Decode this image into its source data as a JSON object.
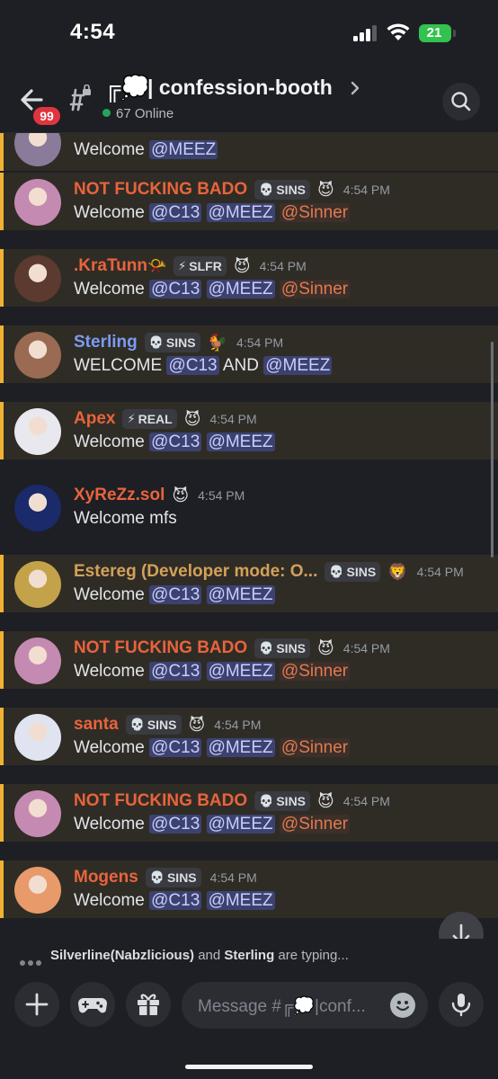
{
  "status_bar": {
    "time": "4:54",
    "battery": "21"
  },
  "header": {
    "unread_badge": "99",
    "channel_emoji": "╔💭",
    "channel_name": "| confession-booth",
    "online": "67 Online"
  },
  "messages": [
    {
      "name": "",
      "name_color": "#e07b4f",
      "tag_icon": "",
      "tag": "",
      "emoji": "",
      "time": "",
      "body": [
        {
          "t": "Welcome "
        },
        {
          "m": "@MEEZ"
        }
      ],
      "highlight": true,
      "avatar": "#8a7b9a"
    },
    {
      "name": "NOT FUCKING BADO",
      "name_color": "#e8643c",
      "tag_icon": "💀",
      "tag": "SINS",
      "emoji": "😈",
      "time": "4:54 PM",
      "body": [
        {
          "t": "Welcome "
        },
        {
          "m": "@C13"
        },
        {
          "t": " "
        },
        {
          "m": "@MEEZ"
        },
        {
          "t": " "
        },
        {
          "r": "@Sinner"
        }
      ],
      "highlight": true,
      "avatar": "#c58ab2"
    },
    {
      "name": ".KraTunn",
      "name_color": "#e8643c",
      "name_suffix": "📯",
      "tag_icon": "⚡",
      "tag": "SLFR",
      "emoji": "😈",
      "time": "4:54 PM",
      "body": [
        {
          "t": "Welcome "
        },
        {
          "m": "@C13"
        },
        {
          "t": " "
        },
        {
          "m": "@MEEZ"
        },
        {
          "t": " "
        },
        {
          "r": "@Sinner"
        }
      ],
      "highlight": true,
      "avatar": "#5c3a30"
    },
    {
      "name": "Sterling",
      "name_color": "#7b9cf0",
      "tag_icon": "💀",
      "tag": "SINS",
      "emoji": "🐓",
      "time": "4:54 PM",
      "body": [
        {
          "t": "WELCOME "
        },
        {
          "m": "@C13"
        },
        {
          "t": " AND "
        },
        {
          "m": "@MEEZ"
        }
      ],
      "highlight": true,
      "avatar": "#9a6a52"
    },
    {
      "name": "Apex",
      "name_color": "#e8643c",
      "tag_icon": "⚡",
      "tag": "REAL",
      "emoji": "😈",
      "time": "4:54 PM",
      "body": [
        {
          "t": "Welcome "
        },
        {
          "m": "@C13"
        },
        {
          "t": " "
        },
        {
          "m": "@MEEZ"
        }
      ],
      "highlight": true,
      "avatar": "#e8e8ee"
    },
    {
      "name": "XyReZz.sol",
      "name_color": "#e8643c",
      "tag_icon": "",
      "tag": "",
      "emoji": "😈",
      "time": "4:54 PM",
      "body": [
        {
          "t": "Welcome mfs"
        }
      ],
      "highlight": false,
      "avatar": "#1a2a6a"
    },
    {
      "name": "Estereg  (Developer mode: O...",
      "name_color": "#d4a15a",
      "tag_icon": "💀",
      "tag": "SINS",
      "emoji": "🦁",
      "time": "4:54 PM",
      "body": [
        {
          "t": "Welcome "
        },
        {
          "m": "@C13"
        },
        {
          "t": " "
        },
        {
          "m": "@MEEZ"
        }
      ],
      "highlight": true,
      "avatar": "#c4a24a"
    },
    {
      "name": "NOT FUCKING BADO",
      "name_color": "#e8643c",
      "tag_icon": "💀",
      "tag": "SINS",
      "emoji": "😈",
      "time": "4:54 PM",
      "body": [
        {
          "t": "Welcome "
        },
        {
          "m": "@C13"
        },
        {
          "t": " "
        },
        {
          "m": "@MEEZ"
        },
        {
          "t": " "
        },
        {
          "r": "@Sinner"
        }
      ],
      "highlight": true,
      "avatar": "#c58ab2"
    },
    {
      "name": "santa",
      "name_color": "#e8643c",
      "tag_icon": "💀",
      "tag": "SINS",
      "emoji": "😈",
      "time": "4:54 PM",
      "body": [
        {
          "t": "Welcome "
        },
        {
          "m": "@C13"
        },
        {
          "t": " "
        },
        {
          "m": "@MEEZ"
        },
        {
          "t": " "
        },
        {
          "r": "@Sinner"
        }
      ],
      "highlight": true,
      "avatar": "#dfe4f0"
    },
    {
      "name": "NOT FUCKING BADO",
      "name_color": "#e8643c",
      "tag_icon": "💀",
      "tag": "SINS",
      "emoji": "😈",
      "time": "4:54 PM",
      "body": [
        {
          "t": "Welcome "
        },
        {
          "m": "@C13"
        },
        {
          "t": " "
        },
        {
          "m": "@MEEZ"
        },
        {
          "t": " "
        },
        {
          "r": "@Sinner"
        }
      ],
      "highlight": true,
      "avatar": "#c58ab2"
    },
    {
      "name": "Mogens",
      "name_color": "#e8643c",
      "tag_icon": "💀",
      "tag": "SINS",
      "emoji": "",
      "time": "4:54 PM",
      "body": [
        {
          "t": "Welcome "
        },
        {
          "m": "@C13"
        },
        {
          "t": " "
        },
        {
          "m": "@MEEZ"
        }
      ],
      "highlight": true,
      "avatar": "#e89a6a"
    }
  ],
  "typing": {
    "user1": "Silverline(Nabzlicious)",
    "joiner": " and ",
    "user2": "Sterling",
    "suffix": " are typing..."
  },
  "composer": {
    "placeholder": "Message #╔💭|conf..."
  },
  "colors": {
    "highlight_bg": "#2f2c26",
    "highlight_border": "#f0b232",
    "mention_bg": "#3c4270",
    "mention_fg": "#c9cdfb",
    "role_fg": "#e07b4f"
  }
}
